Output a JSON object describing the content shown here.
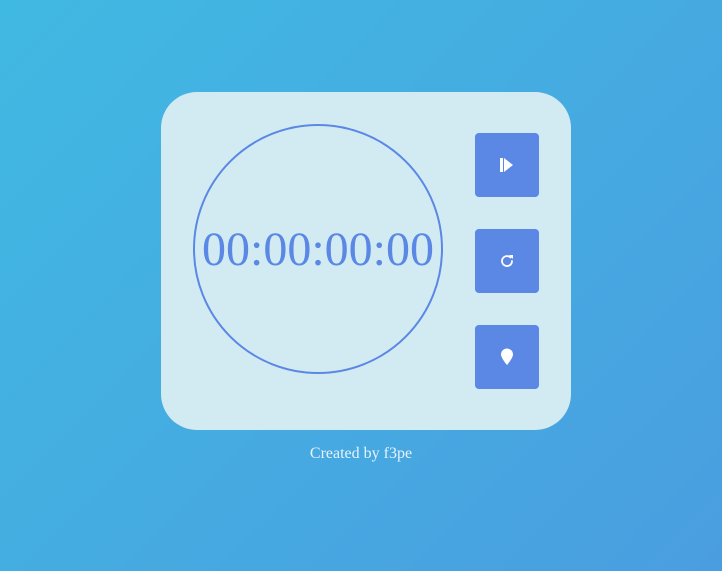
{
  "stopwatch": {
    "time_display": "00:00:00:00"
  },
  "controls": {
    "play_icon": "play-icon",
    "reset_icon": "reset-icon",
    "lap_icon": "map-pin-icon"
  },
  "footer": {
    "credit": "Created by f3pe"
  },
  "colors": {
    "background_start": "#40b9e2",
    "background_end": "#4a9ee0",
    "card": "#d2ebf2",
    "accent": "#5b87e5"
  }
}
